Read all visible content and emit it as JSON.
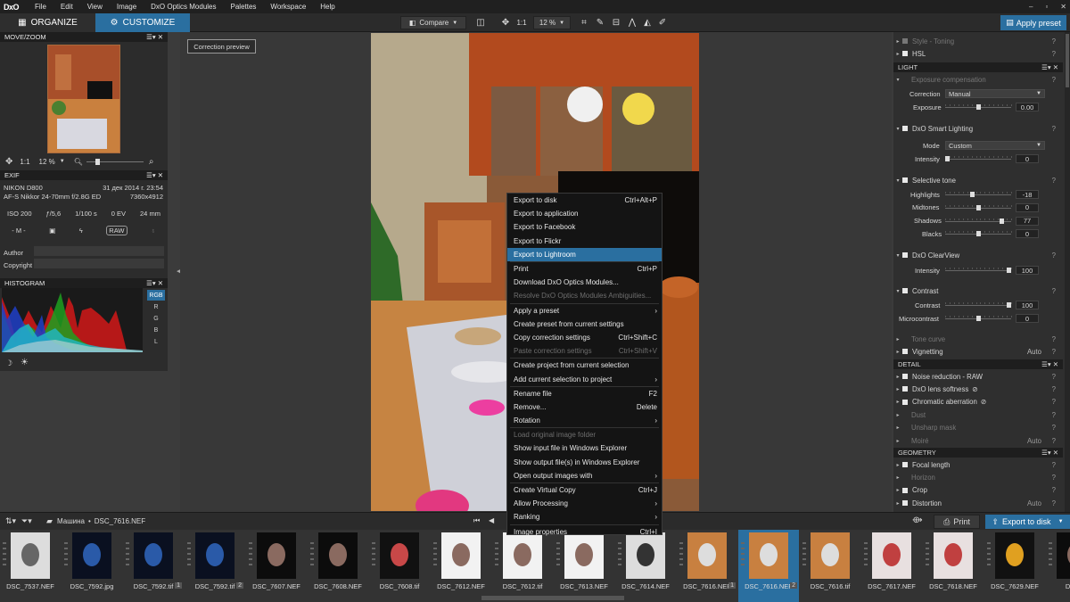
{
  "app": {
    "logo": "DxO",
    "menu": [
      "File",
      "Edit",
      "View",
      "Image",
      "DxO Optics Modules",
      "Palettes",
      "Workspace",
      "Help"
    ],
    "window_controls": [
      "–",
      "▫",
      "✕"
    ]
  },
  "toolbar": {
    "organize": "ORGANIZE",
    "customize": "CUSTOMIZE",
    "compare": "Compare",
    "zoom_mode": "1:1",
    "zoom_value": "12 %",
    "apply_preset": "Apply preset"
  },
  "tooltip": "Correction preview",
  "left": {
    "move_zoom": {
      "title": "MOVE/ZOOM",
      "zoom_mode": "1:1",
      "zoom_value": "12 %"
    },
    "exif": {
      "title": "EXIF",
      "camera": "NIKON D800",
      "date": "31 дек 2014 г. 23:54",
      "lens": "AF-S Nikkor 24-70mm f/2.8G ED",
      "dims": "7360x4912",
      "iso": "ISO 200",
      "aperture": "ƒ/5,6",
      "shutter": "1/100 s",
      "ev": "0 EV",
      "focal": "24 mm",
      "mode": "- M -",
      "raw": "RAW",
      "author_label": "Author",
      "copyright_label": "Copyright"
    },
    "histogram": {
      "title": "HISTOGRAM",
      "channels": [
        "RGB",
        "R",
        "G",
        "B",
        "L"
      ]
    }
  },
  "context_menu": [
    {
      "label": "Export to disk",
      "sc": "Ctrl+Alt+P"
    },
    {
      "label": "Export to application",
      "sc": ""
    },
    {
      "label": "Export to Facebook",
      "sc": ""
    },
    {
      "label": "Export to Flickr",
      "sc": ""
    },
    {
      "label": "Export to Lightroom",
      "sc": "",
      "hl": true
    },
    {
      "label": "Print",
      "sc": "Ctrl+P",
      "sep": true
    },
    {
      "label": "Download DxO Optics Modules...",
      "sc": ""
    },
    {
      "label": "Resolve DxO Optics Modules Ambiguities...",
      "sc": "",
      "dis": true
    },
    {
      "label": "Apply a preset",
      "sc": "›",
      "sep": true
    },
    {
      "label": "Create preset from current settings",
      "sc": ""
    },
    {
      "label": "Copy correction settings",
      "sc": "Ctrl+Shift+C"
    },
    {
      "label": "Paste correction settings",
      "sc": "Ctrl+Shift+V",
      "dis": true
    },
    {
      "label": "Create project from current selection",
      "sc": "",
      "sep": true
    },
    {
      "label": "Add current selection to project",
      "sc": "›"
    },
    {
      "label": "Rename file",
      "sc": "F2",
      "sep": true
    },
    {
      "label": "Remove...",
      "sc": "Delete"
    },
    {
      "label": "Rotation",
      "sc": "›"
    },
    {
      "label": "Load original image folder",
      "sc": "",
      "dis": true,
      "sep": true
    },
    {
      "label": "Show input file in Windows Explorer",
      "sc": ""
    },
    {
      "label": "Show output file(s) in Windows Explorer",
      "sc": ""
    },
    {
      "label": "Open output images with",
      "sc": "›"
    },
    {
      "label": "Create Virtual Copy",
      "sc": "Ctrl+J",
      "sep": true
    },
    {
      "label": "Allow Processing",
      "sc": "›"
    },
    {
      "label": "Ranking",
      "sc": "›"
    },
    {
      "label": "Image properties",
      "sc": "Ctrl+I",
      "sep": true
    }
  ],
  "right": {
    "rows_top": [
      {
        "label": "Style - Toning",
        "dim": true
      },
      {
        "label": "HSL",
        "dim": false
      }
    ],
    "light_title": "LIGHT",
    "exposure": {
      "title": "Exposure compensation",
      "correction_label": "Correction",
      "correction_value": "Manual",
      "exposure_label": "Exposure",
      "exposure_value": "0.00",
      "exposure_level": 0.5
    },
    "smart": {
      "title": "DxO Smart Lighting",
      "mode_label": "Mode",
      "mode_value": "Custom",
      "intensity_label": "Intensity",
      "intensity_value": "0",
      "intensity_level": 0
    },
    "selective": {
      "title": "Selective tone",
      "items": [
        {
          "label": "Highlights",
          "value": "-18",
          "level": 0.41
        },
        {
          "label": "Midtones",
          "value": "0",
          "level": 0.5
        },
        {
          "label": "Shadows",
          "value": "77",
          "level": 0.885
        },
        {
          "label": "Blacks",
          "value": "0",
          "level": 0.5
        }
      ]
    },
    "clearview": {
      "title": "DxO ClearView",
      "intensity_label": "Intensity",
      "intensity_value": "100",
      "intensity_level": 1
    },
    "contrast": {
      "title": "Contrast",
      "items": [
        {
          "label": "Contrast",
          "value": "100",
          "level": 1
        },
        {
          "label": "Microcontrast",
          "value": "0",
          "level": 0.5
        }
      ]
    },
    "tone_curve": "Tone curve",
    "vignetting": {
      "label": "Vignetting",
      "auto": "Auto"
    },
    "detail_title": "DETAIL",
    "detail": [
      {
        "label": "Noise reduction - RAW",
        "dim": false
      },
      {
        "label": "DxO lens softness",
        "dim": false
      },
      {
        "label": "Chromatic aberration",
        "dim": false
      },
      {
        "label": "Dust",
        "dim": true
      },
      {
        "label": "Unsharp mask",
        "dim": true
      },
      {
        "label": "Moiré",
        "dim": true,
        "auto": "Auto"
      }
    ],
    "geometry_title": "GEOMETRY",
    "geometry": [
      {
        "label": "Focal length",
        "dim": false
      },
      {
        "label": "Horizon",
        "dim": true
      },
      {
        "label": "Crop",
        "dim": false
      },
      {
        "label": "Distortion",
        "dim": false,
        "auto": "Auto"
      }
    ]
  },
  "filmbar": {
    "path_root": "Машина",
    "path_sep": "•",
    "path_file": "DSC_7616.NEF",
    "print": "Print",
    "export": "Export to disk"
  },
  "thumbs": [
    {
      "name": "DSC_7537.NEF",
      "badge": "",
      "kind": "chart"
    },
    {
      "name": "DSC_7592.jpg",
      "badge": "",
      "kind": "blue"
    },
    {
      "name": "DSC_7592.tif",
      "badge": "1",
      "kind": "blue"
    },
    {
      "name": "DSC_7592.tif",
      "badge": "2",
      "kind": "blue"
    },
    {
      "name": "DSC_7607.NEF",
      "badge": "",
      "kind": "dark"
    },
    {
      "name": "DSC_7608.NEF",
      "badge": "",
      "kind": "dark"
    },
    {
      "name": "DSC_7608.tif",
      "badge": "",
      "kind": "color"
    },
    {
      "name": "DSC_7612.NEF",
      "badge": "",
      "kind": "white"
    },
    {
      "name": "DSC_7612.tif",
      "badge": "",
      "kind": "white"
    },
    {
      "name": "DSC_7613.NEF",
      "badge": "",
      "kind": "white"
    },
    {
      "name": "DSC_7614.NEF",
      "badge": "",
      "kind": "laptop"
    },
    {
      "name": "DSC_7616.NEF",
      "badge": "1",
      "kind": "room"
    },
    {
      "name": "DSC_7616.NEF",
      "badge": "2",
      "kind": "room",
      "sel": true
    },
    {
      "name": "DSC_7616.tif",
      "badge": "",
      "kind": "room"
    },
    {
      "name": "DSC_7617.NEF",
      "badge": "",
      "kind": "food"
    },
    {
      "name": "DSC_7618.NEF",
      "badge": "",
      "kind": "food"
    },
    {
      "name": "DSC_7629.NEF",
      "badge": "",
      "kind": "bottle"
    },
    {
      "name": "DSC_7",
      "badge": "",
      "kind": "dark"
    }
  ]
}
